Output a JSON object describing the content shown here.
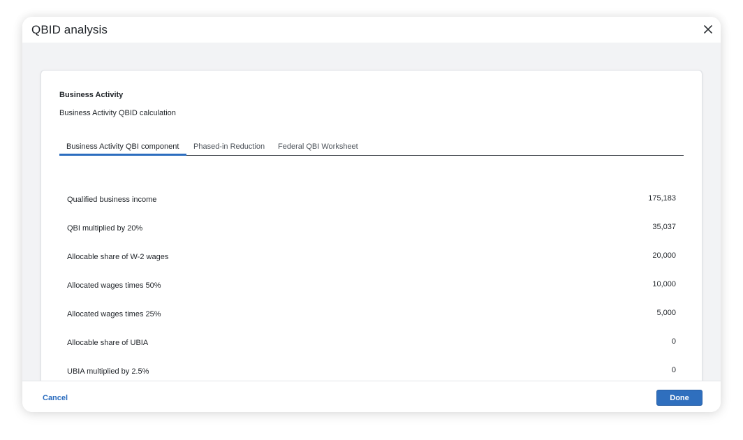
{
  "modal": {
    "title": "QBID analysis",
    "close_icon": "close-icon"
  },
  "card": {
    "title": "Business Activity",
    "subtitle": "Business Activity QBID calculation"
  },
  "tabs": [
    {
      "label": "Business Activity QBI component",
      "active": true
    },
    {
      "label": "Phased-in Reduction",
      "active": false
    },
    {
      "label": "Federal QBI Worksheet",
      "active": false
    }
  ],
  "rows": [
    {
      "label": "Qualified business income",
      "value": "175,183"
    },
    {
      "label": "QBI multiplied by 20%",
      "value": "35,037"
    },
    {
      "label": "Allocable share of W-2 wages",
      "value": "20,000"
    },
    {
      "label": "Allocated wages times 50%",
      "value": "10,000"
    },
    {
      "label": "Allocated wages times 25%",
      "value": "5,000"
    },
    {
      "label": "Allocable share of UBIA",
      "value": "0"
    },
    {
      "label": "UBIA multiplied by 2.5%",
      "value": "0"
    }
  ],
  "footer": {
    "cancel_label": "Cancel",
    "done_label": "Done"
  },
  "colors": {
    "accent": "#2c6dbf",
    "body_bg": "#f2f3f5"
  }
}
